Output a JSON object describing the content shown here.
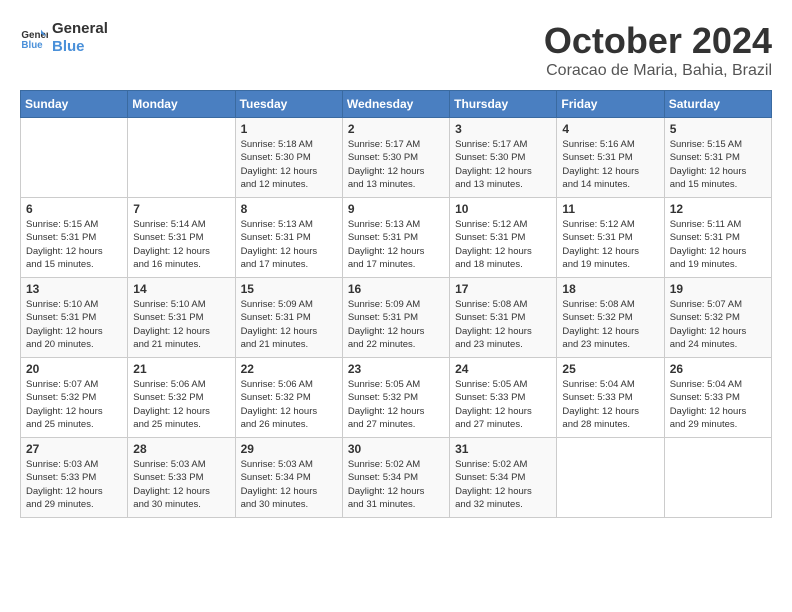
{
  "logo": {
    "line1": "General",
    "line2": "Blue"
  },
  "title": "October 2024",
  "subtitle": "Coracao de Maria, Bahia, Brazil",
  "days_of_week": [
    "Sunday",
    "Monday",
    "Tuesday",
    "Wednesday",
    "Thursday",
    "Friday",
    "Saturday"
  ],
  "weeks": [
    [
      {
        "day": "",
        "info": ""
      },
      {
        "day": "",
        "info": ""
      },
      {
        "day": "1",
        "info": "Sunrise: 5:18 AM\nSunset: 5:30 PM\nDaylight: 12 hours\nand 12 minutes."
      },
      {
        "day": "2",
        "info": "Sunrise: 5:17 AM\nSunset: 5:30 PM\nDaylight: 12 hours\nand 13 minutes."
      },
      {
        "day": "3",
        "info": "Sunrise: 5:17 AM\nSunset: 5:30 PM\nDaylight: 12 hours\nand 13 minutes."
      },
      {
        "day": "4",
        "info": "Sunrise: 5:16 AM\nSunset: 5:31 PM\nDaylight: 12 hours\nand 14 minutes."
      },
      {
        "day": "5",
        "info": "Sunrise: 5:15 AM\nSunset: 5:31 PM\nDaylight: 12 hours\nand 15 minutes."
      }
    ],
    [
      {
        "day": "6",
        "info": "Sunrise: 5:15 AM\nSunset: 5:31 PM\nDaylight: 12 hours\nand 15 minutes."
      },
      {
        "day": "7",
        "info": "Sunrise: 5:14 AM\nSunset: 5:31 PM\nDaylight: 12 hours\nand 16 minutes."
      },
      {
        "day": "8",
        "info": "Sunrise: 5:13 AM\nSunset: 5:31 PM\nDaylight: 12 hours\nand 17 minutes."
      },
      {
        "day": "9",
        "info": "Sunrise: 5:13 AM\nSunset: 5:31 PM\nDaylight: 12 hours\nand 17 minutes."
      },
      {
        "day": "10",
        "info": "Sunrise: 5:12 AM\nSunset: 5:31 PM\nDaylight: 12 hours\nand 18 minutes."
      },
      {
        "day": "11",
        "info": "Sunrise: 5:12 AM\nSunset: 5:31 PM\nDaylight: 12 hours\nand 19 minutes."
      },
      {
        "day": "12",
        "info": "Sunrise: 5:11 AM\nSunset: 5:31 PM\nDaylight: 12 hours\nand 19 minutes."
      }
    ],
    [
      {
        "day": "13",
        "info": "Sunrise: 5:10 AM\nSunset: 5:31 PM\nDaylight: 12 hours\nand 20 minutes."
      },
      {
        "day": "14",
        "info": "Sunrise: 5:10 AM\nSunset: 5:31 PM\nDaylight: 12 hours\nand 21 minutes."
      },
      {
        "day": "15",
        "info": "Sunrise: 5:09 AM\nSunset: 5:31 PM\nDaylight: 12 hours\nand 21 minutes."
      },
      {
        "day": "16",
        "info": "Sunrise: 5:09 AM\nSunset: 5:31 PM\nDaylight: 12 hours\nand 22 minutes."
      },
      {
        "day": "17",
        "info": "Sunrise: 5:08 AM\nSunset: 5:31 PM\nDaylight: 12 hours\nand 23 minutes."
      },
      {
        "day": "18",
        "info": "Sunrise: 5:08 AM\nSunset: 5:32 PM\nDaylight: 12 hours\nand 23 minutes."
      },
      {
        "day": "19",
        "info": "Sunrise: 5:07 AM\nSunset: 5:32 PM\nDaylight: 12 hours\nand 24 minutes."
      }
    ],
    [
      {
        "day": "20",
        "info": "Sunrise: 5:07 AM\nSunset: 5:32 PM\nDaylight: 12 hours\nand 25 minutes."
      },
      {
        "day": "21",
        "info": "Sunrise: 5:06 AM\nSunset: 5:32 PM\nDaylight: 12 hours\nand 25 minutes."
      },
      {
        "day": "22",
        "info": "Sunrise: 5:06 AM\nSunset: 5:32 PM\nDaylight: 12 hours\nand 26 minutes."
      },
      {
        "day": "23",
        "info": "Sunrise: 5:05 AM\nSunset: 5:32 PM\nDaylight: 12 hours\nand 27 minutes."
      },
      {
        "day": "24",
        "info": "Sunrise: 5:05 AM\nSunset: 5:33 PM\nDaylight: 12 hours\nand 27 minutes."
      },
      {
        "day": "25",
        "info": "Sunrise: 5:04 AM\nSunset: 5:33 PM\nDaylight: 12 hours\nand 28 minutes."
      },
      {
        "day": "26",
        "info": "Sunrise: 5:04 AM\nSunset: 5:33 PM\nDaylight: 12 hours\nand 29 minutes."
      }
    ],
    [
      {
        "day": "27",
        "info": "Sunrise: 5:03 AM\nSunset: 5:33 PM\nDaylight: 12 hours\nand 29 minutes."
      },
      {
        "day": "28",
        "info": "Sunrise: 5:03 AM\nSunset: 5:33 PM\nDaylight: 12 hours\nand 30 minutes."
      },
      {
        "day": "29",
        "info": "Sunrise: 5:03 AM\nSunset: 5:34 PM\nDaylight: 12 hours\nand 30 minutes."
      },
      {
        "day": "30",
        "info": "Sunrise: 5:02 AM\nSunset: 5:34 PM\nDaylight: 12 hours\nand 31 minutes."
      },
      {
        "day": "31",
        "info": "Sunrise: 5:02 AM\nSunset: 5:34 PM\nDaylight: 12 hours\nand 32 minutes."
      },
      {
        "day": "",
        "info": ""
      },
      {
        "day": "",
        "info": ""
      }
    ]
  ]
}
